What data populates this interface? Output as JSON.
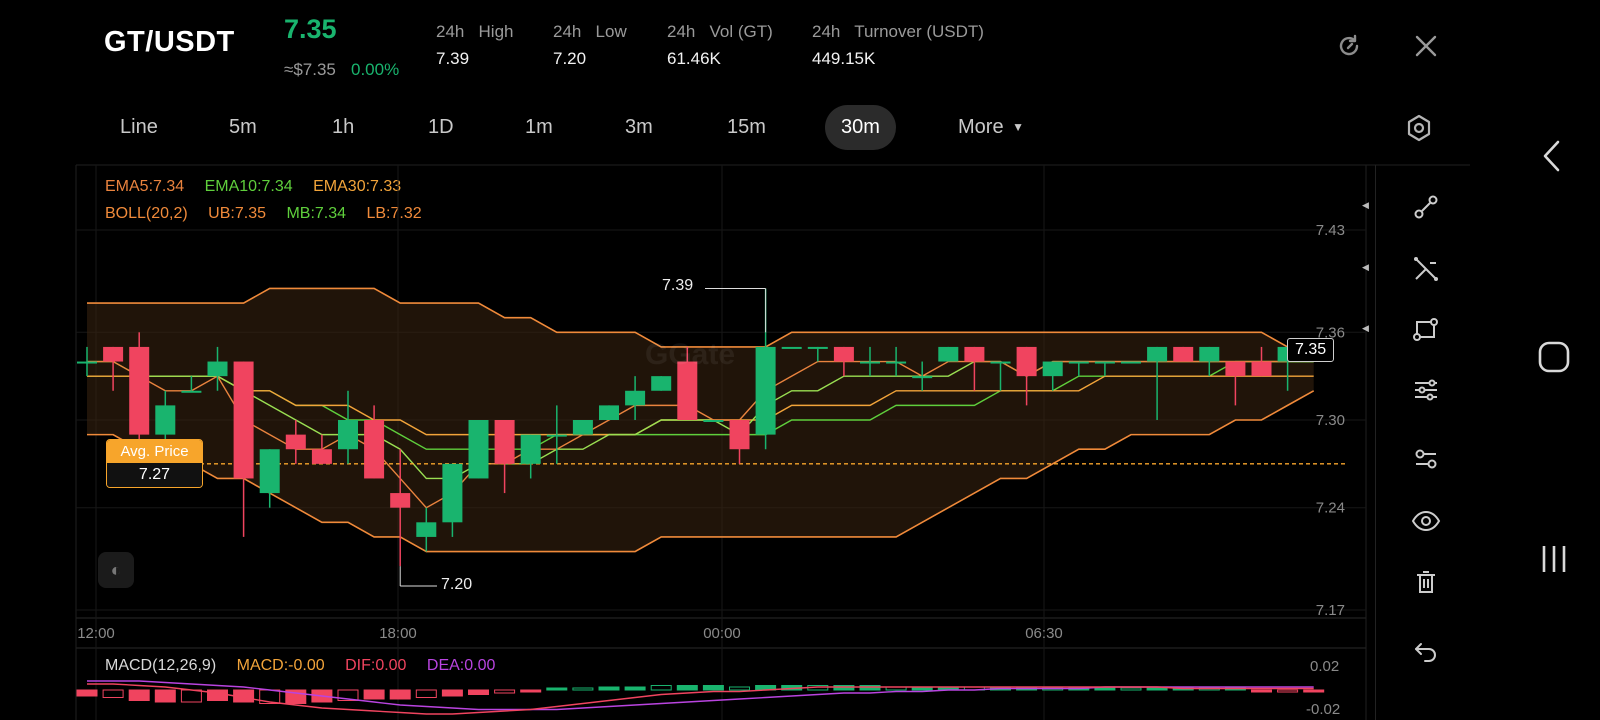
{
  "header": {
    "pair": "GT/USDT",
    "price": "7.35",
    "usd_approx": "≈$7.35",
    "change": "0.00%",
    "stats": [
      {
        "label": "24h   High",
        "value": "7.39"
      },
      {
        "label": "24h   Low",
        "value": "7.20"
      },
      {
        "label": "24h   Vol (GT)",
        "value": "61.46K"
      },
      {
        "label": "24h   Turnover (USDT)",
        "value": "449.15K"
      }
    ],
    "refresh_icon": "refresh-icon",
    "close_icon": "close-icon"
  },
  "tabs": [
    {
      "label": "Line"
    },
    {
      "label": "5m"
    },
    {
      "label": "1h"
    },
    {
      "label": "1D"
    },
    {
      "label": "1m"
    },
    {
      "label": "3m"
    },
    {
      "label": "15m"
    },
    {
      "label": "30m",
      "active": true
    },
    {
      "label": "More"
    }
  ],
  "settings_icon": "hexagon-settings-icon",
  "indicators": {
    "ema5": "EMA5:7.34",
    "ema10": "EMA10:7.34",
    "ema30": "EMA30:7.33",
    "boll": "BOLL(20,2)",
    "ub": "UB:7.35",
    "mb": "MB:7.34",
    "lb": "LB:7.32"
  },
  "avg_price": {
    "label": "Avg. Price",
    "value": "7.27"
  },
  "high_marker": "7.39",
  "low_marker": "7.20",
  "current_price_tag": "7.35",
  "watermark": "GGate",
  "macd": {
    "title": "MACD(12,26,9)",
    "macd": "MACD:-0.00",
    "dif": "DIF:0.00",
    "dea": "DEA:0.00",
    "y_ticks": [
      "0.02",
      "-0.02"
    ]
  },
  "colors": {
    "up": "#19b46e",
    "down": "#f0445f",
    "ema5": "#e9833e",
    "ema10": "#5fcf3c",
    "ema30": "#f2a43a",
    "boll": "#f08a3a",
    "dif": "#f0445f",
    "dea": "#b944e0",
    "avg": "#f7a52b"
  },
  "chart_data": {
    "type": "candlestick",
    "x_ticks": [
      "12:00",
      "18:00",
      "00:00",
      "06:30"
    ],
    "y_ticks": [
      7.43,
      7.36,
      7.3,
      7.24,
      7.17
    ],
    "ylim": [
      7.16,
      7.45
    ],
    "candles": [
      {
        "o": 7.34,
        "h": 7.35,
        "l": 7.33,
        "c": 7.34
      },
      {
        "o": 7.35,
        "h": 7.35,
        "l": 7.32,
        "c": 7.34
      },
      {
        "o": 7.35,
        "h": 7.36,
        "l": 7.28,
        "c": 7.29
      },
      {
        "o": 7.29,
        "h": 7.32,
        "l": 7.27,
        "c": 7.31
      },
      {
        "o": 7.32,
        "h": 7.33,
        "l": 7.32,
        "c": 7.32
      },
      {
        "o": 7.33,
        "h": 7.35,
        "l": 7.32,
        "c": 7.34
      },
      {
        "o": 7.34,
        "h": 7.34,
        "l": 7.22,
        "c": 7.26
      },
      {
        "o": 7.25,
        "h": 7.28,
        "l": 7.24,
        "c": 7.28
      },
      {
        "o": 7.29,
        "h": 7.3,
        "l": 7.27,
        "c": 7.28
      },
      {
        "o": 7.28,
        "h": 7.29,
        "l": 7.27,
        "c": 7.27
      },
      {
        "o": 7.28,
        "h": 7.32,
        "l": 7.27,
        "c": 7.3
      },
      {
        "o": 7.3,
        "h": 7.31,
        "l": 7.26,
        "c": 7.26
      },
      {
        "o": 7.25,
        "h": 7.28,
        "l": 7.2,
        "c": 7.24
      },
      {
        "o": 7.22,
        "h": 7.24,
        "l": 7.21,
        "c": 7.23
      },
      {
        "o": 7.23,
        "h": 7.27,
        "l": 7.22,
        "c": 7.27
      },
      {
        "o": 7.26,
        "h": 7.3,
        "l": 7.26,
        "c": 7.3
      },
      {
        "o": 7.3,
        "h": 7.3,
        "l": 7.25,
        "c": 7.27
      },
      {
        "o": 7.27,
        "h": 7.29,
        "l": 7.26,
        "c": 7.29
      },
      {
        "o": 7.29,
        "h": 7.31,
        "l": 7.27,
        "c": 7.29
      },
      {
        "o": 7.29,
        "h": 7.3,
        "l": 7.29,
        "c": 7.3
      },
      {
        "o": 7.3,
        "h": 7.31,
        "l": 7.3,
        "c": 7.31
      },
      {
        "o": 7.31,
        "h": 7.33,
        "l": 7.3,
        "c": 7.32
      },
      {
        "o": 7.32,
        "h": 7.33,
        "l": 7.32,
        "c": 7.33
      },
      {
        "o": 7.34,
        "h": 7.35,
        "l": 7.3,
        "c": 7.3
      },
      {
        "o": 7.3,
        "h": 7.3,
        "l": 7.3,
        "c": 7.3
      },
      {
        "o": 7.3,
        "h": 7.3,
        "l": 7.27,
        "c": 7.28
      },
      {
        "o": 7.29,
        "h": 7.39,
        "l": 7.28,
        "c": 7.35
      },
      {
        "o": 7.35,
        "h": 7.35,
        "l": 7.35,
        "c": 7.35
      },
      {
        "o": 7.35,
        "h": 7.35,
        "l": 7.34,
        "c": 7.35
      },
      {
        "o": 7.35,
        "h": 7.35,
        "l": 7.33,
        "c": 7.34
      },
      {
        "o": 7.34,
        "h": 7.35,
        "l": 7.33,
        "c": 7.34
      },
      {
        "o": 7.34,
        "h": 7.35,
        "l": 7.33,
        "c": 7.34
      },
      {
        "o": 7.33,
        "h": 7.34,
        "l": 7.32,
        "c": 7.33
      },
      {
        "o": 7.34,
        "h": 7.35,
        "l": 7.34,
        "c": 7.35
      },
      {
        "o": 7.35,
        "h": 7.35,
        "l": 7.32,
        "c": 7.34
      },
      {
        "o": 7.34,
        "h": 7.34,
        "l": 7.32,
        "c": 7.34
      },
      {
        "o": 7.35,
        "h": 7.35,
        "l": 7.31,
        "c": 7.33
      },
      {
        "o": 7.33,
        "h": 7.34,
        "l": 7.32,
        "c": 7.34
      },
      {
        "o": 7.34,
        "h": 7.34,
        "l": 7.33,
        "c": 7.34
      },
      {
        "o": 7.34,
        "h": 7.34,
        "l": 7.33,
        "c": 7.34
      },
      {
        "o": 7.34,
        "h": 7.34,
        "l": 7.34,
        "c": 7.34
      },
      {
        "o": 7.34,
        "h": 7.35,
        "l": 7.3,
        "c": 7.35
      },
      {
        "o": 7.35,
        "h": 7.35,
        "l": 7.34,
        "c": 7.34
      },
      {
        "o": 7.34,
        "h": 7.35,
        "l": 7.33,
        "c": 7.35
      },
      {
        "o": 7.34,
        "h": 7.34,
        "l": 7.31,
        "c": 7.33
      },
      {
        "o": 7.34,
        "h": 7.35,
        "l": 7.33,
        "c": 7.33
      },
      {
        "o": 7.34,
        "h": 7.35,
        "l": 7.32,
        "c": 7.35
      },
      {
        "o": 7.35,
        "h": 7.35,
        "l": 7.35,
        "c": 7.35
      }
    ],
    "boll_ub": [
      7.38,
      7.38,
      7.38,
      7.38,
      7.38,
      7.38,
      7.38,
      7.39,
      7.39,
      7.39,
      7.39,
      7.39,
      7.38,
      7.38,
      7.38,
      7.38,
      7.37,
      7.37,
      7.36,
      7.36,
      7.36,
      7.36,
      7.35,
      7.35,
      7.35,
      7.35,
      7.35,
      7.36,
      7.36,
      7.36,
      7.36,
      7.36,
      7.36,
      7.36,
      7.36,
      7.36,
      7.36,
      7.36,
      7.36,
      7.36,
      7.36,
      7.36,
      7.36,
      7.36,
      7.36,
      7.36,
      7.35,
      7.35
    ],
    "boll_mb": [
      7.33,
      7.33,
      7.33,
      7.33,
      7.33,
      7.33,
      7.32,
      7.32,
      7.31,
      7.31,
      7.3,
      7.3,
      7.29,
      7.28,
      7.28,
      7.28,
      7.28,
      7.28,
      7.29,
      7.29,
      7.29,
      7.29,
      7.29,
      7.29,
      7.29,
      7.29,
      7.29,
      7.3,
      7.3,
      7.3,
      7.3,
      7.31,
      7.31,
      7.31,
      7.31,
      7.32,
      7.32,
      7.32,
      7.33,
      7.33,
      7.33,
      7.33,
      7.33,
      7.33,
      7.34,
      7.34,
      7.34,
      7.34
    ],
    "boll_lb": [
      7.29,
      7.29,
      7.28,
      7.28,
      7.27,
      7.26,
      7.26,
      7.25,
      7.24,
      7.23,
      7.23,
      7.22,
      7.22,
      7.21,
      7.21,
      7.21,
      7.21,
      7.21,
      7.21,
      7.21,
      7.21,
      7.21,
      7.22,
      7.22,
      7.22,
      7.22,
      7.22,
      7.22,
      7.22,
      7.22,
      7.22,
      7.22,
      7.23,
      7.24,
      7.25,
      7.26,
      7.26,
      7.27,
      7.28,
      7.28,
      7.29,
      7.29,
      7.29,
      7.29,
      7.3,
      7.3,
      7.31,
      7.32
    ],
    "ema5": [
      7.34,
      7.34,
      7.33,
      7.32,
      7.32,
      7.33,
      7.3,
      7.29,
      7.28,
      7.28,
      7.29,
      7.28,
      7.26,
      7.24,
      7.25,
      7.27,
      7.27,
      7.28,
      7.28,
      7.29,
      7.3,
      7.31,
      7.31,
      7.31,
      7.3,
      7.3,
      7.32,
      7.33,
      7.34,
      7.34,
      7.34,
      7.34,
      7.33,
      7.34,
      7.34,
      7.34,
      7.33,
      7.34,
      7.34,
      7.34,
      7.34,
      7.34,
      7.34,
      7.34,
      7.34,
      7.34,
      7.34,
      7.35
    ],
    "ema10": [
      7.34,
      7.34,
      7.33,
      7.33,
      7.33,
      7.33,
      7.32,
      7.31,
      7.3,
      7.29,
      7.29,
      7.29,
      7.28,
      7.26,
      7.26,
      7.27,
      7.27,
      7.27,
      7.28,
      7.28,
      7.29,
      7.29,
      7.3,
      7.3,
      7.3,
      7.29,
      7.31,
      7.32,
      7.32,
      7.33,
      7.33,
      7.33,
      7.33,
      7.33,
      7.34,
      7.34,
      7.33,
      7.34,
      7.34,
      7.34,
      7.34,
      7.34,
      7.34,
      7.34,
      7.34,
      7.34,
      7.34,
      7.34
    ],
    "ema30": [
      7.33,
      7.33,
      7.33,
      7.33,
      7.33,
      7.33,
      7.32,
      7.32,
      7.31,
      7.31,
      7.31,
      7.3,
      7.3,
      7.29,
      7.29,
      7.29,
      7.29,
      7.29,
      7.29,
      7.29,
      7.29,
      7.29,
      7.3,
      7.3,
      7.3,
      7.3,
      7.3,
      7.31,
      7.31,
      7.31,
      7.31,
      7.32,
      7.32,
      7.32,
      7.32,
      7.32,
      7.32,
      7.32,
      7.32,
      7.33,
      7.33,
      7.33,
      7.33,
      7.33,
      7.33,
      7.33,
      7.33,
      7.33
    ],
    "macd_hist": [
      -0.004,
      -0.005,
      -0.007,
      -0.008,
      -0.008,
      -0.007,
      -0.008,
      -0.009,
      -0.009,
      -0.008,
      -0.007,
      -0.006,
      -0.006,
      -0.005,
      -0.004,
      -0.003,
      -0.002,
      -0.001,
      0.0,
      0.001,
      0.002,
      0.002,
      0.003,
      0.003,
      0.003,
      0.002,
      0.003,
      0.003,
      0.003,
      0.003,
      0.003,
      0.002,
      0.002,
      0.002,
      0.002,
      0.002,
      0.001,
      0.001,
      0.001,
      0.001,
      0.0,
      0.0,
      0.0,
      0.0,
      0.0,
      -0.001,
      -0.001,
      -0.001
    ],
    "dif": [
      0.004,
      0.004,
      0.003,
      0.002,
      0.0,
      -0.002,
      -0.005,
      -0.008,
      -0.01,
      -0.012,
      -0.013,
      -0.014,
      -0.015,
      -0.016,
      -0.016,
      -0.015,
      -0.014,
      -0.013,
      -0.011,
      -0.009,
      -0.007,
      -0.005,
      -0.003,
      -0.002,
      -0.001,
      -0.001,
      0.0,
      0.001,
      0.002,
      0.002,
      0.002,
      0.002,
      0.002,
      0.002,
      0.002,
      0.002,
      0.002,
      0.002,
      0.002,
      0.002,
      0.002,
      0.002,
      0.001,
      0.001,
      0.001,
      0.001,
      0.001,
      0.001
    ],
    "dea": [
      0.006,
      0.006,
      0.006,
      0.005,
      0.004,
      0.003,
      0.002,
      0.0,
      -0.002,
      -0.004,
      -0.006,
      -0.008,
      -0.01,
      -0.011,
      -0.012,
      -0.013,
      -0.013,
      -0.013,
      -0.013,
      -0.012,
      -0.011,
      -0.01,
      -0.009,
      -0.008,
      -0.007,
      -0.006,
      -0.005,
      -0.004,
      -0.003,
      -0.002,
      -0.002,
      -0.001,
      -0.001,
      0.0,
      0.0,
      0.001,
      0.001,
      0.001,
      0.001,
      0.002,
      0.002,
      0.002,
      0.002,
      0.002,
      0.002,
      0.002,
      0.002,
      0.002
    ]
  }
}
